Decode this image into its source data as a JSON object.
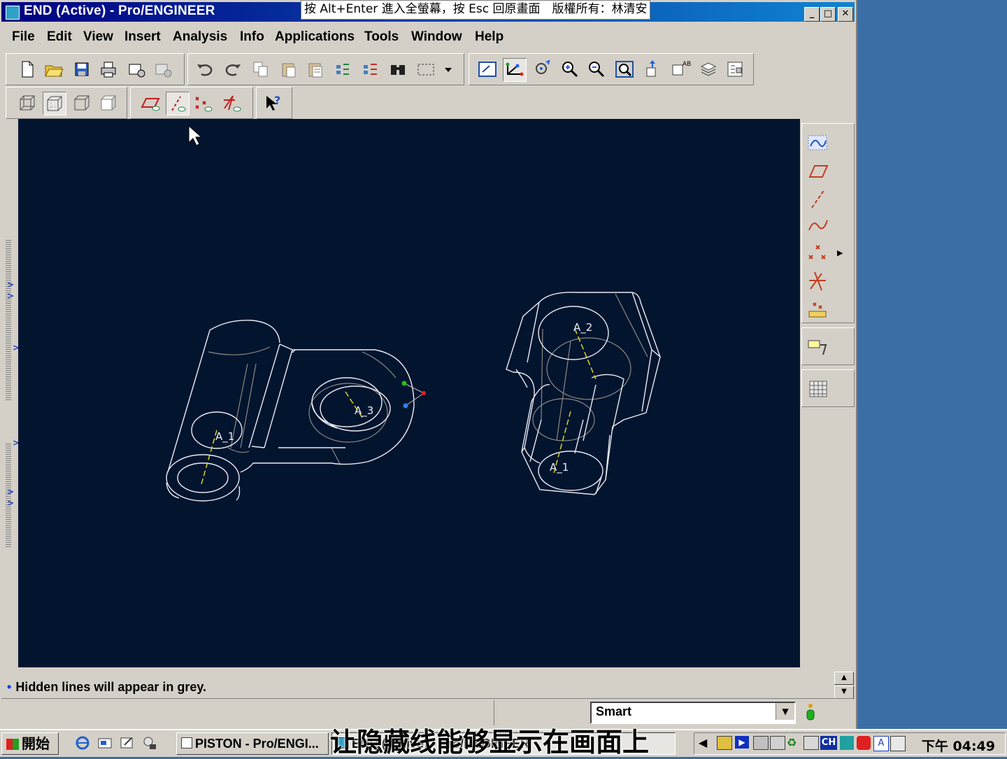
{
  "window": {
    "title": "END (Active) - Pro/ENGINEER"
  },
  "overlay_note": "按 Alt+Enter 進入全螢幕，按 Esc 回原畫面　版權所有：林清安",
  "menu": [
    "File",
    "Edit",
    "View",
    "Insert",
    "Analysis",
    "Info",
    "Applications",
    "Tools",
    "Window",
    "Help"
  ],
  "canvas": {
    "background": "#03142f",
    "datum_labels": {
      "left_a1": "A_1",
      "left_a3": "A_3",
      "right_a2": "A_2",
      "right_a1": "A_1"
    }
  },
  "message": "Hidden lines will appear in grey.",
  "selection_filter": "Smart",
  "taskbar": {
    "start_label": "開始",
    "task1": "PISTON - Pro/ENGI...",
    "task2": "END (Active) - Pro/ENGINEER",
    "clock": "下午 04:49"
  },
  "subtitle": "让隐藏线能够显示在画面上"
}
